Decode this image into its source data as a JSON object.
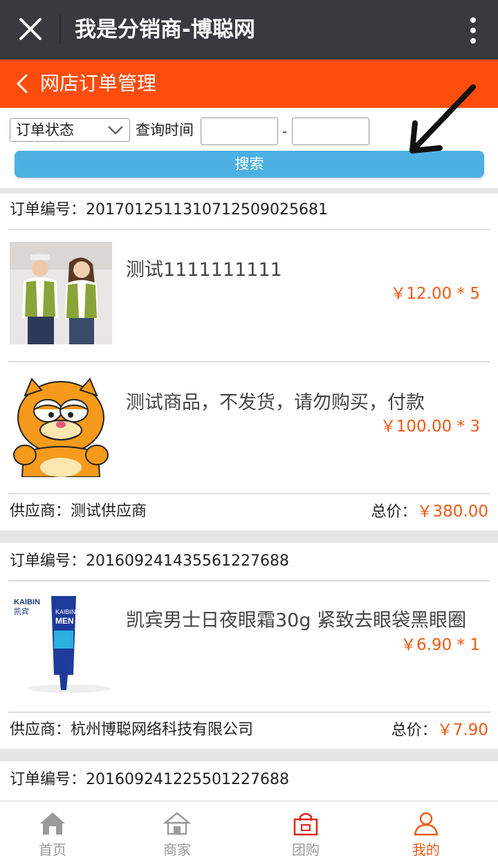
{
  "titlebar": {
    "title": "我是分销商-博聪网"
  },
  "navbar": {
    "title": "网店订单管理"
  },
  "filter": {
    "status_label": "订单状态",
    "query_time_label": "查询时间",
    "date_from": "",
    "date_to": "",
    "dash": "-",
    "search_label": "搜索"
  },
  "orders": [
    {
      "number_label": "订单编号：",
      "number": "20170125113107125090256​81",
      "items": [
        {
          "name": "测试1111111111",
          "price": "￥12.00 * 5",
          "image": "couple-vests-photo"
        },
        {
          "name": "测试商品，不发货，请勿购买，付款",
          "price": "￥100.00 * 3",
          "image": "garfield-cartoon"
        }
      ],
      "supplier_label": "供应商：",
      "supplier": "测试供应商",
      "total_label": "总价：",
      "total": "￥380.00"
    },
    {
      "number_label": "订单编号：",
      "number": "2016092414355612276​88",
      "items": [
        {
          "name": "凯宾男士日夜眼霜30g 紧致去眼袋黑眼圈",
          "price": "￥6.90 * 1",
          "image": "eye-cream-tube",
          "brand_text": "KAIBIN",
          "brand_cn": "凯宾",
          "tube_text": "MEN"
        }
      ],
      "supplier_label": "供应商：",
      "supplier": "杭州博聪网络科技有限公司",
      "total_label": "总价：",
      "total": "￥7.90"
    },
    {
      "number_label": "订单编号：",
      "number": "201609241225501227688"
    }
  ],
  "tabs": [
    {
      "label": "首页",
      "icon": "home-icon",
      "active": false
    },
    {
      "label": "商家",
      "icon": "store-icon",
      "active": false
    },
    {
      "label": "团购",
      "icon": "shopping-bag-icon",
      "active": false
    },
    {
      "label": "我的",
      "icon": "user-icon",
      "active": true
    }
  ],
  "colors": {
    "accent": "#ff4d0d",
    "price": "#f05a14",
    "button": "#4db0e2",
    "titlebar": "#393a3f"
  }
}
